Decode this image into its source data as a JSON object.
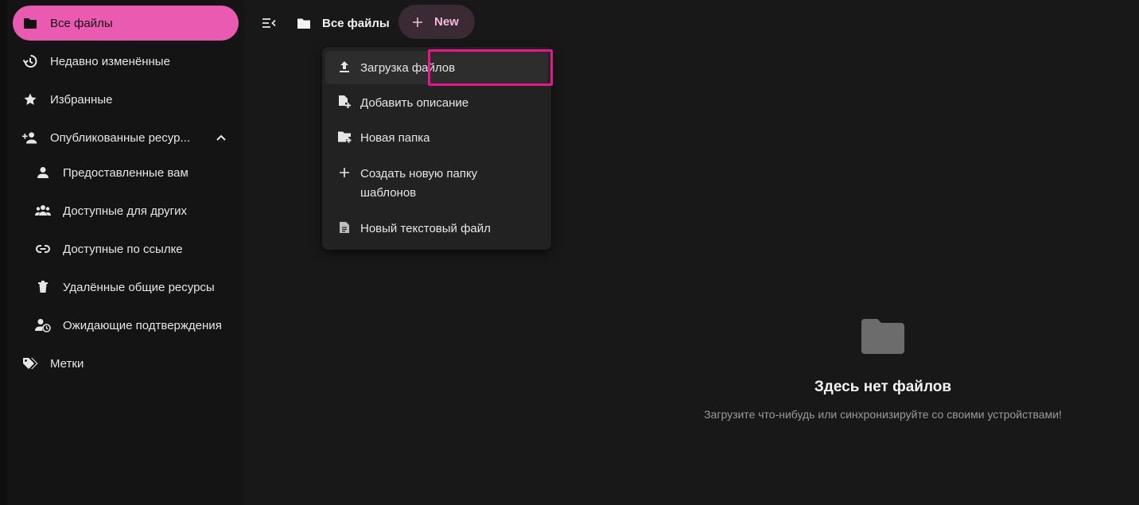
{
  "sidebar": {
    "items": [
      {
        "label": "Все файлы",
        "icon": "folder-icon"
      },
      {
        "label": "Недавно изменённые",
        "icon": "history-icon"
      },
      {
        "label": "Избранные",
        "icon": "star-icon"
      },
      {
        "label": "Опубликованные ресур...",
        "icon": "person-add-icon"
      },
      {
        "label": "Предоставленные вам",
        "icon": "person-icon"
      },
      {
        "label": "Доступные для других",
        "icon": "group-icon"
      },
      {
        "label": "Доступные по ссылке",
        "icon": "link-icon"
      },
      {
        "label": "Удалённые общие ресурсы",
        "icon": "trash-icon"
      },
      {
        "label": "Ожидающие подтверждения",
        "icon": "person-clock-icon"
      },
      {
        "label": "Метки",
        "icon": "tag-icon"
      }
    ]
  },
  "header": {
    "breadcrumb": "Все файлы",
    "new_label": "New"
  },
  "menu": {
    "items": [
      {
        "label": "Загрузка файлов",
        "icon": "upload-icon"
      },
      {
        "label": "Добавить описание",
        "icon": "file-plus-icon"
      },
      {
        "label": "Новая папка",
        "icon": "folder-plus-icon"
      },
      {
        "label": "Создать новую папку шаблонов",
        "icon": "plus-icon"
      },
      {
        "label": "Новый текстовый файл",
        "icon": "text-file-icon"
      }
    ]
  },
  "empty": {
    "title": "Здесь нет файлов",
    "subtitle": "Загрузите что-нибудь или синхронизируйте со своими устройствами!"
  },
  "colors": {
    "accent": "#e95ab0",
    "highlight_box": "#e8168a",
    "background": "#181818"
  }
}
